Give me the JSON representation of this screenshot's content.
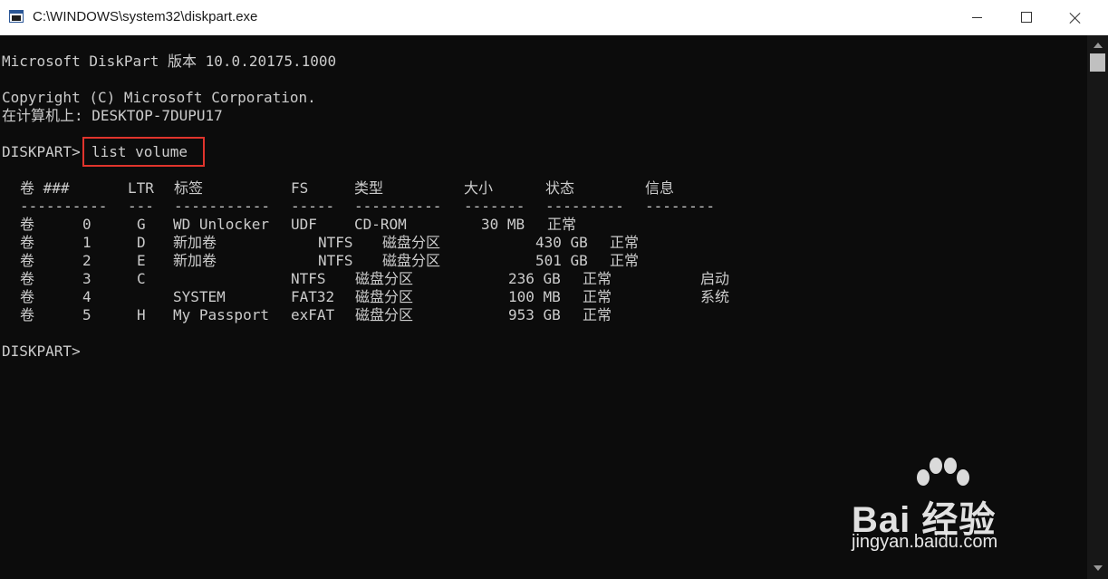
{
  "window": {
    "title": "C:\\WINDOWS\\system32\\diskpart.exe",
    "minimize_glyph": "minimize-icon",
    "maximize_glyph": "maximize-icon",
    "close_glyph": "close-icon"
  },
  "console": {
    "version_line": "Microsoft DiskPart 版本 10.0.20175.1000",
    "copyright_line": "Copyright (C) Microsoft Corporation.",
    "computer_line": "在计算机上: DESKTOP-7DUPU17",
    "prompt": "DISKPART>",
    "command": "list volume",
    "highlight_color": "#e0342c",
    "text_color": "#cccccc",
    "background_color": "#0c0c0c"
  },
  "volume_table": {
    "headers": {
      "vol": "卷 ###",
      "ltr": "LTR",
      "label": "标签",
      "fs": "FS",
      "type": "类型",
      "size": "大小",
      "status": "状态",
      "info": "信息"
    },
    "separators": {
      "vol": "----------",
      "ltr": "---",
      "label": "-----------",
      "fs": "-----",
      "type": "----------",
      "size": "-------",
      "status": "---------",
      "info": "--------"
    },
    "rows": [
      {
        "vol": "卷",
        "num": "0",
        "ltr": "G",
        "label": "WD Unlocker",
        "fs": "UDF",
        "type": "CD-ROM",
        "size": "30 MB",
        "status": "正常",
        "info": ""
      },
      {
        "vol": "卷",
        "num": "1",
        "ltr": "D",
        "label": "新加卷",
        "fs": "NTFS",
        "type": "磁盘分区",
        "size": "430 GB",
        "status": "正常",
        "info": ""
      },
      {
        "vol": "卷",
        "num": "2",
        "ltr": "E",
        "label": "新加卷",
        "fs": "NTFS",
        "type": "磁盘分区",
        "size": "501 GB",
        "status": "正常",
        "info": ""
      },
      {
        "vol": "卷",
        "num": "3",
        "ltr": "C",
        "label": "",
        "fs": "NTFS",
        "type": "磁盘分区",
        "size": "236 GB",
        "status": "正常",
        "info": "启动"
      },
      {
        "vol": "卷",
        "num": "4",
        "ltr": "",
        "label": "SYSTEM",
        "fs": "FAT32",
        "type": "磁盘分区",
        "size": "100 MB",
        "status": "正常",
        "info": "系统"
      },
      {
        "vol": "卷",
        "num": "5",
        "ltr": "H",
        "label": "My Passport",
        "fs": "exFAT",
        "type": "磁盘分区",
        "size": "953 GB",
        "status": "正常",
        "info": ""
      }
    ]
  },
  "watermark": {
    "brand": "Bai 经验",
    "url": "jingyan.baidu.com"
  }
}
